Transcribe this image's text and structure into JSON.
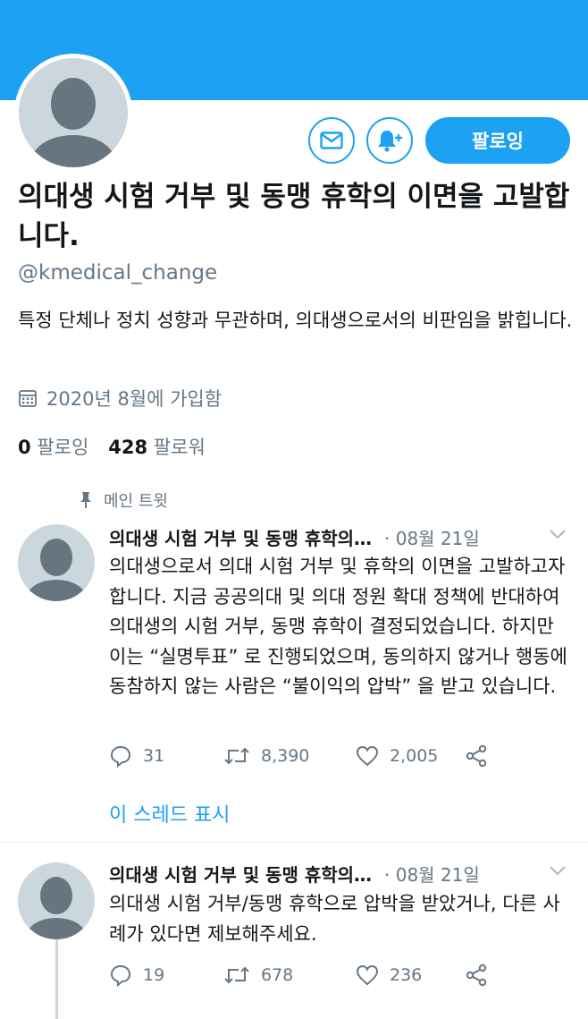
{
  "profile": {
    "name": "의대생 시험 거부 및 동맹 휴학의 이면을 고발합니다.",
    "handle": "@kmedical_change",
    "bio": "특정 단체나 정치 성향과 무관하며, 의대생으로서의 비판임을 밝힙니다.",
    "joined": "2020년 8월에 가입함",
    "following_count": "0",
    "following_label": "팔로잉",
    "followers_count": "428",
    "followers_label": "팔로워",
    "follow_button": "팔로잉"
  },
  "pinned_label": "메인 트윗",
  "tweets": [
    {
      "author": "의대생 시험 거부 및 동맹 휴학의…",
      "date": "· 08월 21일",
      "text": "의대생으로서 의대 시험 거부 및 휴학의 이면을 고발하고자 합니다. 지금 공공의대 및 의대 정원 확대 정책에 반대하여 의대생의 시험 거부, 동맹 휴학이 결정되었습니다. 하지만 이는 “실명투표” 로 진행되었으며, 동의하지 않거나 행동에 동참하지 않는 사람은 “불이익의 압박” 을 받고 있습니다.",
      "replies": "31",
      "retweets": "8,390",
      "likes": "2,005"
    },
    {
      "author": "의대생 시험 거부 및 동맹 휴학의…",
      "date": "· 08월 21일",
      "text": "의대생 시험 거부/동맹 휴학으로 압박을 받았거나, 다른 사례가 있다면 제보해주세요.",
      "replies": "19",
      "retweets": "678",
      "likes": "236"
    }
  ],
  "show_thread": "이 스레드 표시",
  "colors": {
    "accent": "#1da1f2",
    "muted": "#657786",
    "text": "#14171a",
    "avatar_bg": "#ccd6dd"
  },
  "icons": [
    "mail-icon",
    "bell-plus-icon",
    "calendar-icon",
    "pin-icon",
    "chevron-down-icon",
    "reply-icon",
    "retweet-icon",
    "like-icon",
    "share-icon"
  ]
}
